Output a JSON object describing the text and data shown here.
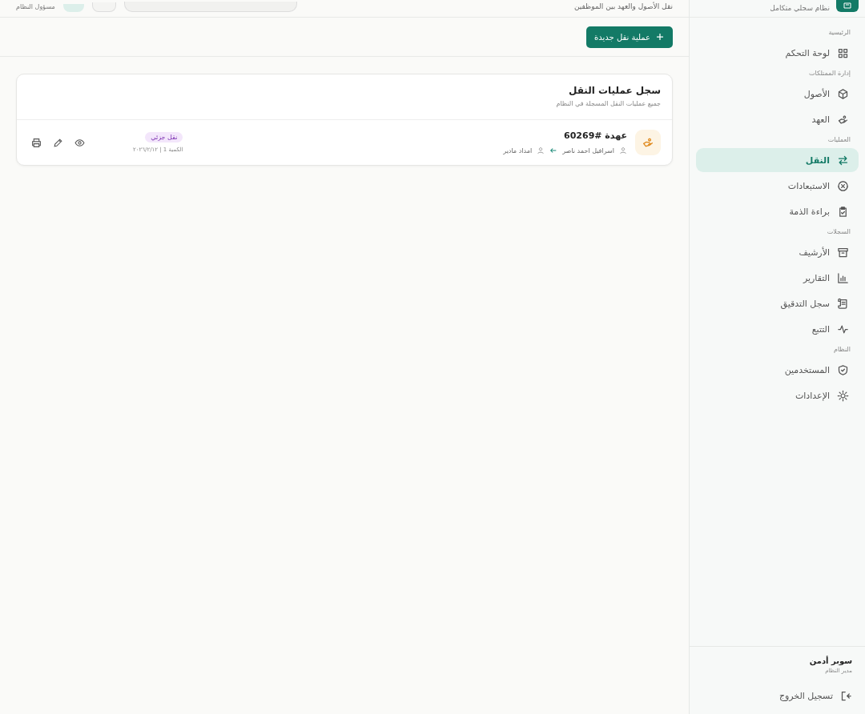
{
  "sidebar": {
    "brand": "نظام سجلي متكامل",
    "sections": [
      {
        "title": "الرئيسية",
        "items": [
          {
            "label": "لوحة التحكم",
            "selected": false
          }
        ]
      },
      {
        "title": "إدارة الممتلكات",
        "items": [
          {
            "label": "الأصول",
            "selected": false
          },
          {
            "label": "العهد",
            "selected": false
          }
        ]
      },
      {
        "title": "العمليات",
        "items": [
          {
            "label": "النقل",
            "selected": true
          },
          {
            "label": "الاستبعادات",
            "selected": false
          },
          {
            "label": "براءة الذمة",
            "selected": false
          }
        ]
      },
      {
        "title": "السجلات",
        "items": [
          {
            "label": "الأرشيف",
            "selected": false
          },
          {
            "label": "التقارير",
            "selected": false
          },
          {
            "label": "سجل التدقيق",
            "selected": false
          },
          {
            "label": "التتبع",
            "selected": false
          }
        ]
      },
      {
        "title": "النظام",
        "items": [
          {
            "label": "المستخدمين",
            "selected": false
          },
          {
            "label": "الإعدادات",
            "selected": false
          }
        ]
      }
    ],
    "user": {
      "name": "سوبر أدمن",
      "role": "مدير النظام"
    },
    "logout": "تسجيل الخروج"
  },
  "header": {
    "subtitle": "نقل الأصول والعهد بين الموظفين",
    "user_role": "مسؤول النظام"
  },
  "toolbar": {
    "new_button": "عملية نقل جديدة"
  },
  "card": {
    "title": "سجل عمليات النقل",
    "subtitle": "جميع عمليات النقل المسجلة في النظام",
    "rows": [
      {
        "title": "عهدة #60269",
        "from": "اسرافيل احمد ناصر",
        "to": "امداد مادير",
        "badge": "نقل جزئي",
        "meta": "الكمية 1 | ٢٠٢٦/٢/١٢"
      }
    ]
  }
}
